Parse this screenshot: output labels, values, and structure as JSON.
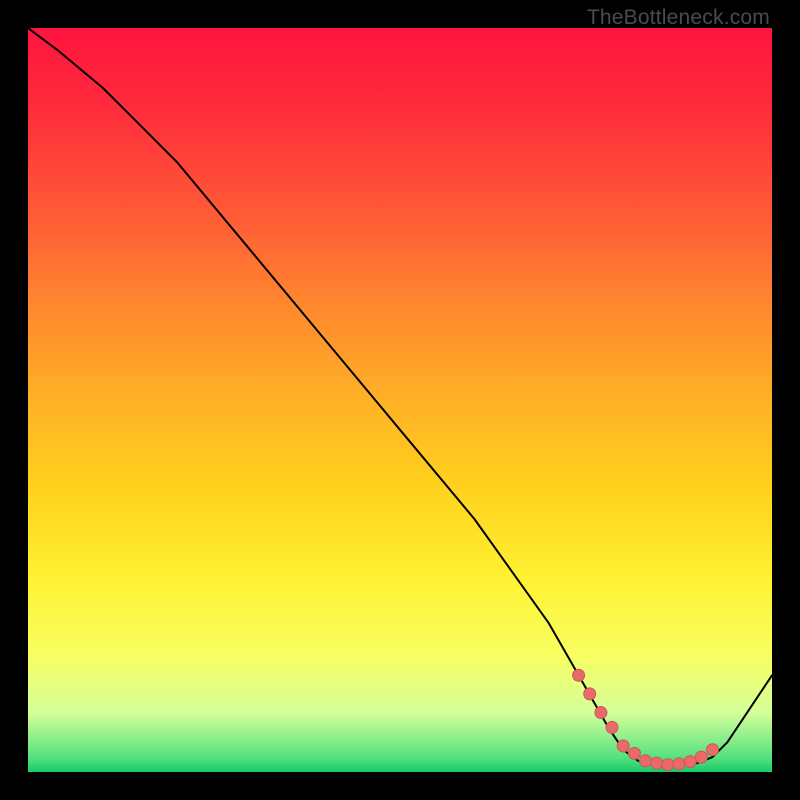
{
  "watermark": "TheBottleneck.com",
  "colors": {
    "curve_stroke": "#000000",
    "marker_fill": "#e86a6a",
    "marker_stroke": "#cf5757"
  },
  "chart_data": {
    "type": "line",
    "title": "",
    "xlabel": "",
    "ylabel": "",
    "xlim": [
      0,
      100
    ],
    "ylim": [
      0,
      100
    ],
    "grid": false,
    "legend": false,
    "series": [
      {
        "name": "curve",
        "x": [
          0,
          4,
          10,
          20,
          30,
          40,
          50,
          60,
          70,
          74,
          78,
          80,
          82,
          84,
          86,
          88,
          90,
          92,
          94,
          100
        ],
        "y": [
          100,
          97,
          92,
          82,
          70,
          58,
          46,
          34,
          20,
          13,
          6,
          3,
          1.5,
          1,
          1,
          1,
          1.2,
          2,
          4,
          13
        ]
      }
    ],
    "markers": {
      "name": "highlight-markers",
      "x": [
        74,
        75.5,
        77,
        78.5,
        80,
        81.5,
        83,
        84.5,
        86,
        87.5,
        89,
        90.5,
        92
      ],
      "y": [
        13,
        10.5,
        8,
        6,
        3.5,
        2.5,
        1.5,
        1.2,
        1.0,
        1.1,
        1.4,
        2.0,
        3.0
      ]
    },
    "comment": "y-values estimated from plot: 100=top (red), 0=bottom (green). The trough sits ~1 near x≈84–88."
  }
}
